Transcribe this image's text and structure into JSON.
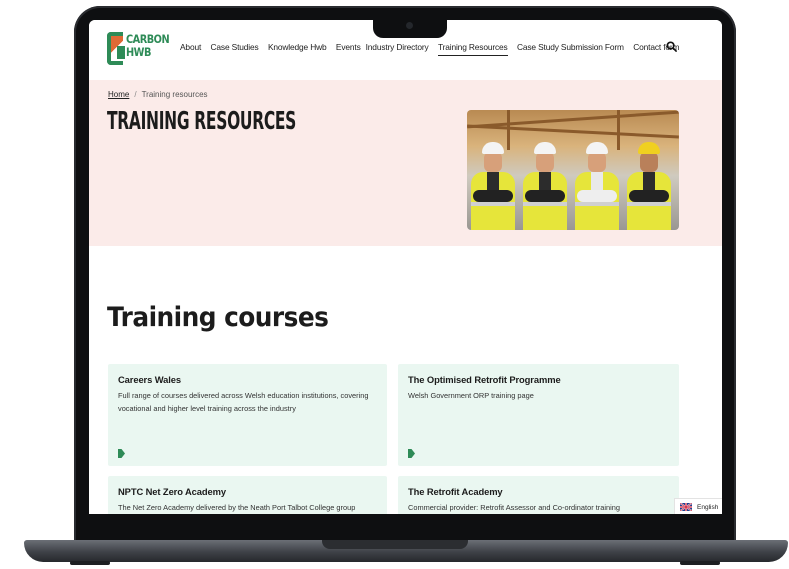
{
  "logo": {
    "line1": "CARBON",
    "line2": "HWB"
  },
  "nav": {
    "items": [
      "About",
      "Case Studies",
      "Knowledge Hwb",
      "Events",
      "Industry Directory",
      "Training Resources",
      "Case Study Submission Form",
      "Contact form"
    ],
    "active": "Training Resources"
  },
  "breadcrumb": {
    "home": "Home",
    "separator": "/",
    "current": "Training resources"
  },
  "hero": {
    "title": "TRAINING RESOURCES"
  },
  "main": {
    "section_title": "Training courses",
    "cards": [
      {
        "title": "Careers Wales",
        "description": "Full range of courses delivered across Welsh education institutions, covering vocational and higher level training across the industry"
      },
      {
        "title": "The Optimised Retrofit Programme",
        "description": "Welsh Government ORP training page"
      },
      {
        "title": "NPTC Net Zero Academy",
        "description": "The Net Zero Academy delivered by the Neath Port Talbot College group"
      },
      {
        "title": "The Retrofit Academy",
        "description": "Commercial provider: Retrofit Assessor and Co-ordinator training"
      }
    ]
  },
  "language": {
    "label": "English"
  },
  "colors": {
    "brand_green": "#2e8b57",
    "brand_orange": "#e06a35",
    "hero_bg": "#fbebe9",
    "card_bg": "#eaf7f1"
  }
}
